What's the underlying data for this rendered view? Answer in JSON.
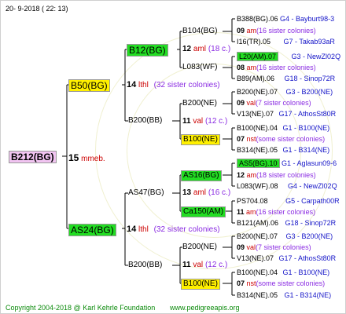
{
  "header": {
    "date": "20-  9-2018 (  22:  13)"
  },
  "root": {
    "name": "B212(BG)",
    "gen": "15",
    "mate": "mmeb."
  },
  "sire": {
    "name": "B50(BG)",
    "gen": "14",
    "mate": "lthl",
    "colonies": "(32 sister colonies)",
    "a": {
      "name": "B12(BG)",
      "p1": {
        "name": "B104(BG)",
        "gen": "12",
        "mate": "aml",
        "colonies": "(18 c.)",
        "q1": {
          "name": "B388(BG).06",
          "group": "G4 - Bayburt98-3"
        },
        "q1c": {
          "gen": "09",
          "mate": "am",
          "colonies": "(16 sister colonies)"
        },
        "q2": {
          "name": "I16(TR).05",
          "group": "G7 - Takab93aR"
        }
      },
      "p2": {
        "name": "L083(WF)",
        "gen": "08",
        "mate": "am",
        "colonies": "(16 sister colonies)",
        "q1": {
          "name": "L20(AM).07",
          "group": "G3 - NewZl02Q"
        },
        "q2": {
          "name": "B89(AM).06",
          "group": "G18 - Sinop72R"
        }
      }
    },
    "b": {
      "name": "B200(BB)",
      "p1": {
        "name": "B200(NE)",
        "gen": "11",
        "mate": "val",
        "colonies": "(12 c.)",
        "q1": {
          "name": "B200(NE).07",
          "group": "G3 - B200(NE)"
        },
        "q1c": {
          "gen": "09",
          "mate": "val",
          "colonies": "(7 sister colonies)"
        },
        "q2": {
          "name": "V13(NE).07",
          "group": "G17 - AthosSt80R"
        }
      },
      "p2": {
        "name": "B100(NE)",
        "gen": "07",
        "mate": "nst",
        "colonies": "(some sister colonies)",
        "q1": {
          "name": "B100(NE).04",
          "group": "G1 - B100(NE)"
        },
        "q2": {
          "name": "B314(NE).05",
          "group": "G1 - B314(NE)"
        }
      }
    }
  },
  "dam": {
    "name": "AS24(BG)",
    "gen": "14",
    "mate": "lthl",
    "colonies": "(32 sister colonies)",
    "a": {
      "name": "AS47(BG)",
      "p1": {
        "name": "AS16(BG)",
        "gen": "13",
        "mate": "aml",
        "colonies": "(16 c.)",
        "q1": {
          "name": "AS5(BG).10",
          "group": "G1 - Aglasun09-6"
        },
        "q1c": {
          "gen": "12",
          "mate": "am",
          "colonies": "(18 sister colonies)"
        },
        "q2": {
          "name": "L083(WF).08",
          "group": "G4 - NewZl02Q"
        }
      },
      "p2": {
        "name": "Ca150(AM)",
        "gen": "11",
        "mate": "am",
        "colonies": "(16 sister colonies)",
        "q1": {
          "name": "PS704.08",
          "group": "G5 - Carpath00R"
        },
        "q2": {
          "name": "B121(AM).06",
          "group": "G18 - Sinop72R"
        }
      }
    },
    "b": {
      "name": "B200(BB)",
      "p1": {
        "name": "B200(NE)",
        "gen": "11",
        "mate": "val",
        "colonies": "(12 c.)",
        "q1": {
          "name": "B200(NE).07",
          "group": "G3 - B200(NE)"
        },
        "q1c": {
          "gen": "09",
          "mate": "val",
          "colonies": "(7 sister colonies)"
        },
        "q2": {
          "name": "V13(NE).07",
          "group": "G17 - AthosSt80R"
        }
      },
      "p2": {
        "name": "B100(NE)",
        "gen": "07",
        "mate": "nst",
        "colonies": "(some sister colonies)",
        "q1": {
          "name": "B100(NE).04",
          "group": "G1 - B100(NE)"
        },
        "q2": {
          "name": "B314(NE).05",
          "group": "G1 - B314(NE)"
        }
      }
    }
  },
  "footer": {
    "copyright": "Copyright 2004-2018 @ Karl Kehrle Foundation",
    "site": "www.pedigreeapis.org"
  }
}
